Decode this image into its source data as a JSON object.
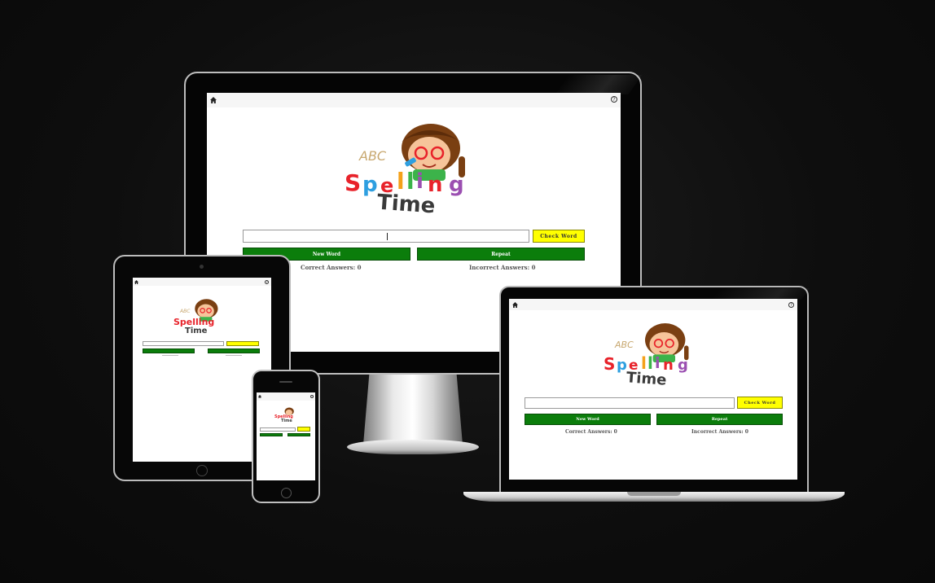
{
  "app": {
    "logo_abc": "ABC",
    "logo_line1": "Spelling",
    "logo_line2": "Time",
    "home_icon": "home-icon",
    "help_icon": "help-icon",
    "help_glyph": "?",
    "check_label": "Check Word",
    "new_word_label": "New Word",
    "repeat_label": "Repeat",
    "correct_label": "Correct Answers: 0",
    "incorrect_label": "Incorrect Answers: 0",
    "word_input_value": ""
  },
  "colors": {
    "spelling_letters": [
      "#e8222a",
      "#2e9fe0",
      "#e8222a",
      "#f4a11b",
      "#3cb34a",
      "#9b4fb1",
      "#e8222a",
      "#9b4fb1"
    ],
    "check_button": "#ffff00",
    "action_buttons": "#0b7d0b",
    "frame": "#000000"
  }
}
